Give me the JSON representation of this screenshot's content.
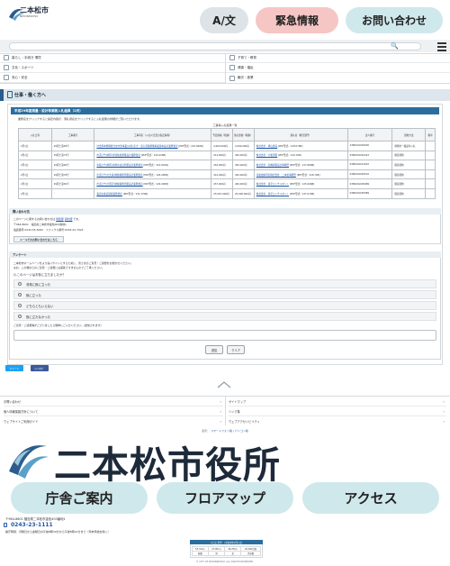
{
  "header": {
    "logo_text": "二本松市",
    "logo_sub": "NIHONMATSU",
    "lang_label": "A/文",
    "emergency_label": "緊急情報",
    "contact_label": "お問い合わせ"
  },
  "nav": {
    "items": [
      "暮らし・手続き 環境",
      "子育て・教育",
      "健康・福祉",
      "文化・スポーツ",
      "観光・産業",
      "安心・安全"
    ]
  },
  "page": {
    "title": "仕事・働く方へ",
    "subhead": "平成29年度測量・設計等業務入札結果（2月）",
    "lead": "業務名をクリックすると指定内容が、落札者名をクリックすると入札結果の詳細がご覧いただけます。",
    "caption": "工事等入札結果一覧"
  },
  "table": {
    "headers": [
      "入札日等",
      "工事番号",
      "工事等名（入札公告及び指定情報）",
      "予定価格（税抜）",
      "落札金額（税抜）",
      "落札者（経営部門）",
      "法人番号",
      "契約方法",
      "備考"
    ],
    "rows": [
      [
        "2月1日",
        "29区土第83号",
        "社会資本整備総合交付金事業(災害)安全・安心道路整備事業基本設計業務委託",
        "[PDF形式／223.00KB]",
        "4,600,000円",
        "4,000,000円",
        "株式会社　横山建設",
        "[PDF形式／128.07KB]",
        "2380001005000",
        "制限付一般競争入札",
        ""
      ],
      [
        "2月1日",
        "29区土第73号",
        "市道上竹(地区)歩道拡幅測量設計業務委託",
        "[PDF形式／120.42KB]",
        "414,000円",
        "400,000円",
        "株式会社　大和測量",
        "[PDF形式／126.1KB]",
        "0380001004423",
        "随意契約",
        ""
      ],
      [
        "2月1日",
        "29区土第82号",
        "水路上竹(地区)用排水改良測量設計業務委託",
        "[PDF形式／110.61KB]",
        "452,000円",
        "450,000円",
        "株式会社　信橋調量設計事務所",
        "[PDF形式／127.80KB]",
        "0380001012010",
        "随意契約",
        ""
      ],
      [
        "2月1日",
        "29区土第78号",
        "市道上竹(大久保)地線補修測量設計業務委託",
        "[PDF形式／126.29KB]",
        "441,000円",
        "420,000円",
        "協和技術研究株式会社　二本松事務所",
        "[PDF形式／126.7KB]",
        "0380001005510",
        "随意契約",
        ""
      ],
      [
        "2月1日",
        "29区土第81号",
        "市道上竹(大原沢)地線補修測量設計業務委託",
        "[PDF形式／129.20KB]",
        "457,000円",
        "400,000円",
        "株式会社　東草コンサルタント",
        "[PDF形式／125.09KB]",
        "0380001005989",
        "随意契約",
        ""
      ],
      [
        "2月1日",
        "-",
        "業者主確認調査業務委託",
        "[PDF形式／131.37KB]",
        "25,567,000円",
        "25,000,000円",
        "株式会社　東草コンサルタント",
        "[PDF形式／137.07KB]",
        "0380001005989",
        "随意契約",
        ""
      ]
    ]
  },
  "contact": {
    "heading": "問い合わせ先",
    "line1_pre": "このページに関するお問い合わせは",
    "line1_link1": "財政部",
    "line1_link2": "契約課",
    "line1_post": "です。",
    "line2": "〒964-8601　福島県二本松市金色403番地1",
    "line3": "電話番号:0243-55-5062　ファックス番号:0243-22-7023",
    "mail_button": "メールでのお問い合わせはこちら"
  },
  "survey": {
    "heading": "アンケート",
    "intro1": "二本松市ホームページをより良いサイトにするために、皆さまのご意見・ご感想をお聞かせください。",
    "intro2": "なお、この欄からのご意見・ご感想には返答できませんのでご了承ください。",
    "question": "Q.このページはお役に立ちましたか？",
    "options": [
      "非常に役に立った",
      "役に立った",
      "どちらともいえない",
      "役に立たなかった"
    ],
    "comment_label": "ご意見・ご感想等がございましたら簡単にご入力ください。(送信されます)",
    "send": "送信",
    "clear": "クリア"
  },
  "social": {
    "twitter": "ツイート",
    "facebook": "いいね！"
  },
  "footer": {
    "links": [
      "お問い合わせ",
      "サイトマップ",
      "個人情報保護方針について",
      "リンク集",
      "ウェブサイトご利用ガイド",
      "ウェブアクセシビリティ"
    ],
    "small_pre": "表示：",
    "small_mobile": "スマートフォン版",
    "small_pc": "パソコン版",
    "city_name": "二本松市役所",
    "pills": [
      "庁舎ご案内",
      "フロアマップ",
      "アクセス"
    ],
    "address": "〒964-8601 福島県二本松市金色403番地1",
    "phone": "0243-23-1111",
    "hours": "開庁時間：月曜日から金曜日の午前8時30分から午後5時15分まで（年末年始を除く）",
    "counter_heading": "人口と世帯　(令和2年2月1日)",
    "counter_rows": [
      [
        "53,314人",
        "27,001人",
        "26,700人",
        "20,991世帯"
      ],
      [
        "総数",
        "男",
        "女",
        "世帯数"
      ]
    ],
    "copyright": "© CITY OF NIHONMATSU. ALL RIGHTS RESERVED."
  }
}
